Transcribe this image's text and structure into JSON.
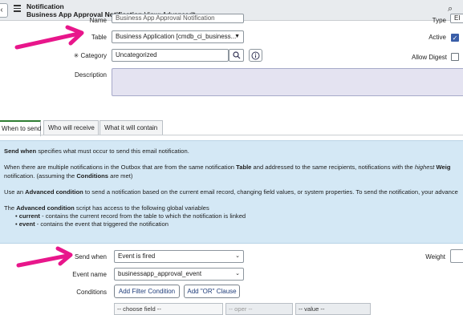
{
  "header": {
    "title": "Notification",
    "subtitle": "Business App Approval Notification",
    "view_label": "View: Advanced*"
  },
  "form": {
    "name_label": "Name",
    "name_value": "Business App Approval Notification",
    "table_label": "Table",
    "table_value": "Business Application [cmdb_ci_business...",
    "category_required": "✳",
    "category_label": "Category",
    "category_value": "Uncategorized",
    "description_label": "Description",
    "description_value": "",
    "type_label": "Type",
    "type_value": "EI",
    "active_label": "Active",
    "active_checked": true,
    "allow_digest_label": "Allow Digest",
    "allow_digest_checked": false
  },
  "tabs": [
    {
      "label": "When to send",
      "active": true
    },
    {
      "label": "Who will receive",
      "active": false
    },
    {
      "label": "What it will contain",
      "active": false
    }
  ],
  "info": {
    "line1_bold": "Send when",
    "line1_rest": " specifies what must occur to send this email notification.",
    "line2_a": "When there are multiple notifications in the Outbox that are from the same notification ",
    "line2_b": "Table",
    "line2_c": " and addressed to the same recipients, notifications with the ",
    "line2_d": "highest",
    "line2_e": " Weig",
    "line3_a": "notification. (assuming the ",
    "line3_b": "Conditions",
    "line3_c": " are met)",
    "line4_a": "Use an ",
    "line4_b": "Advanced condition",
    "line4_c": " to send a notification based on the current email record, changing field values, or system properties. To send the notification, your advance",
    "line5_a": "The ",
    "line5_b": "Advanced condition",
    "line5_c": " script has access to the following global variables",
    "bullet1_b": "current",
    "bullet1_rest": " - contains the current record from the table to which the notification is linked",
    "bullet2_b": "event",
    "bullet2_rest": " - contains the event that triggered the notification"
  },
  "when": {
    "send_when_label": "Send when",
    "send_when_value": "Event is fired",
    "event_name_label": "Event name",
    "event_name_value": "businessapp_approval_event",
    "conditions_label": "Conditions",
    "add_filter_label": "Add Filter Condition",
    "add_or_label": "Add \"OR\" Clause",
    "weight_label": "Weight",
    "choose_field": "-- choose field --",
    "oper": "-- oper --",
    "value": "-- value --"
  },
  "colors": {
    "annotation": "#e8168b",
    "info_bg": "#d4e8f5",
    "active_tab": "#2e7d32"
  }
}
